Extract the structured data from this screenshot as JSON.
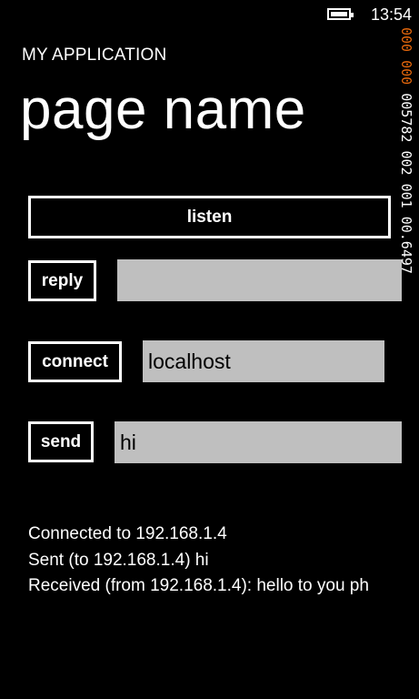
{
  "status_bar": {
    "time": "13:54",
    "battery_level": 1.0
  },
  "debug_counters": {
    "orange_text": "000 000",
    "white_text": "005782 002 001 00.6497"
  },
  "header": {
    "app_title": "MY APPLICATION",
    "page_title": "page name"
  },
  "controls": {
    "listen_label": "listen",
    "reply_label": "reply",
    "reply_value": "",
    "connect_label": "connect",
    "connect_value": "localhost",
    "send_label": "send",
    "send_value": "hi"
  },
  "log": [
    "Connected to 192.168.1.4",
    "Sent (to 192.168.1.4) hi",
    "Received (from 192.168.1.4): hello to you ph"
  ]
}
